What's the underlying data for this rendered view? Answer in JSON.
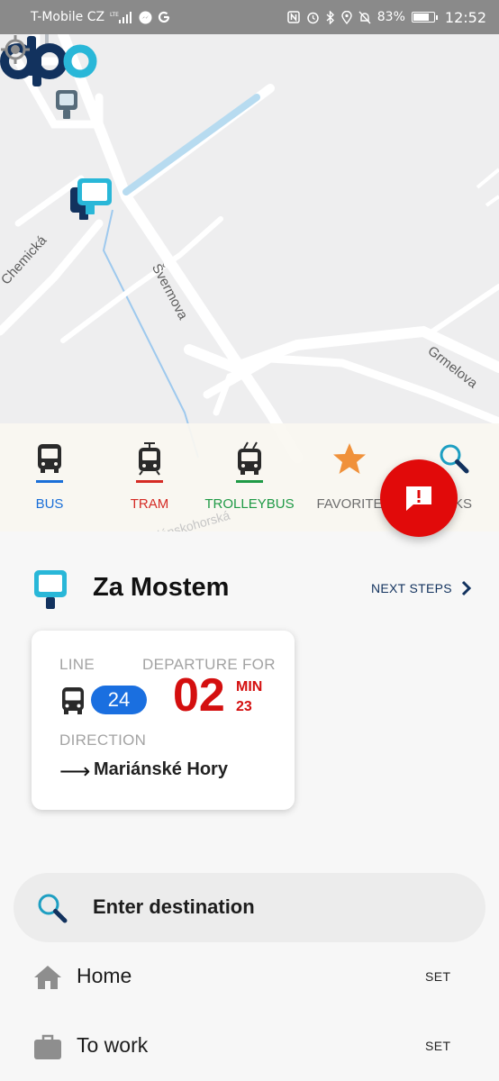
{
  "status_bar": {
    "carrier": "T-Mobile CZ",
    "network": "LTE",
    "battery": "83%",
    "battery_level": 0.83,
    "time": "12:52"
  },
  "map": {
    "streets": [
      "Chemická",
      "Švermova",
      "Grmelova",
      "Mariánskohorská"
    ]
  },
  "transport_tabs": [
    {
      "label": "BUS",
      "color": "#1a6fd8",
      "icon": "bus-icon"
    },
    {
      "label": "TRAM",
      "color": "#d52b25",
      "icon": "tram-icon"
    },
    {
      "label": "TROLLEYBUS",
      "color": "#1f9a46",
      "icon": "trolleybus-icon"
    },
    {
      "label": "FAVORITE",
      "color": "#6e6e6e",
      "icon": "star-icon"
    },
    {
      "label": "KS",
      "color": "#6e6e6e",
      "icon": "search-icon"
    }
  ],
  "stop": {
    "name": "Za Mostem",
    "next_steps": "NEXT STEPS"
  },
  "departure": {
    "line_label": "LINE",
    "line_number": "24",
    "departure_label": "DEPARTURE FOR",
    "minutes": "02",
    "min_label": "MIN",
    "seconds": "23",
    "direction_label": "DIRECTION",
    "direction": "Mariánské Hory"
  },
  "search": {
    "placeholder": "Enter destination"
  },
  "places": [
    {
      "label": "Home",
      "action": "SET",
      "icon": "home-icon"
    },
    {
      "label": "To work",
      "action": "SET",
      "icon": "briefcase-icon"
    }
  ],
  "colors": {
    "accent_red": "#e10a0a",
    "brand_navy": "#12325e",
    "brand_cyan": "#29b7d8",
    "line_blue": "#1a6fe0"
  }
}
